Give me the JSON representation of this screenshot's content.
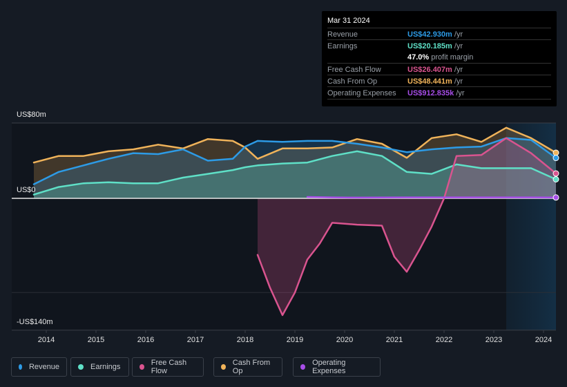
{
  "tooltip": {
    "date": "Mar 31 2024",
    "rows": [
      {
        "label": "Revenue",
        "value": "US$42.930m",
        "unit": "/yr",
        "color": "#2d9be6"
      },
      {
        "label": "Earnings",
        "value": "US$20.185m",
        "unit": "/yr",
        "color": "#5fe0c7"
      },
      {
        "label": "",
        "value": "47.0%",
        "unit": "profit margin",
        "color": "#ffffff"
      },
      {
        "label": "Free Cash Flow",
        "value": "US$26.407m",
        "unit": "/yr",
        "color": "#d9548f"
      },
      {
        "label": "Cash From Op",
        "value": "US$48.441m",
        "unit": "/yr",
        "color": "#f0b35a"
      },
      {
        "label": "Operating Expenses",
        "value": "US$912.835k",
        "unit": "/yr",
        "color": "#a74ee8"
      }
    ]
  },
  "legend": [
    {
      "label": "Revenue",
      "color": "#2d9be6"
    },
    {
      "label": "Earnings",
      "color": "#5fe0c7"
    },
    {
      "label": "Free Cash Flow",
      "color": "#d9548f"
    },
    {
      "label": "Cash From Op",
      "color": "#f0b35a"
    },
    {
      "label": "Operating Expenses",
      "color": "#a74ee8"
    }
  ],
  "chart_data": {
    "type": "area",
    "title": "",
    "xlabel": "",
    "ylabel": "",
    "y_tick_labels": [
      "US$80m",
      "US$0",
      "-US$140m"
    ],
    "ylim": [
      -140,
      80
    ],
    "xlim": [
      2013.75,
      2024.25
    ],
    "x_tick_labels": [
      "2014",
      "2015",
      "2016",
      "2017",
      "2018",
      "2019",
      "2020",
      "2021",
      "2022",
      "2023",
      "2024"
    ],
    "x_ticks": [
      2014,
      2015,
      2016,
      2017,
      2018,
      2019,
      2020,
      2021,
      2022,
      2023,
      2024
    ],
    "forecast_region_start": 2023.25,
    "series": [
      {
        "name": "Cash From Op",
        "color": "#f0b35a",
        "x": [
          2013.75,
          2014.25,
          2014.75,
          2015.25,
          2015.75,
          2016.25,
          2016.75,
          2017.25,
          2017.75,
          2018.0,
          2018.25,
          2018.75,
          2019.25,
          2019.75,
          2020.25,
          2020.75,
          2021.25,
          2021.75,
          2022.25,
          2022.75,
          2023.25,
          2023.75,
          2024.25
        ],
        "values": [
          38,
          45,
          45,
          50,
          52,
          57,
          53,
          63,
          61,
          54,
          42,
          53,
          53,
          54,
          63,
          58,
          43,
          64,
          68,
          60,
          75,
          64,
          48.441
        ]
      },
      {
        "name": "Revenue",
        "color": "#2d9be6",
        "x": [
          2013.75,
          2014.25,
          2014.75,
          2015.25,
          2015.75,
          2016.25,
          2016.75,
          2017.25,
          2017.75,
          2018.0,
          2018.25,
          2018.75,
          2019.25,
          2019.75,
          2020.25,
          2020.75,
          2021.25,
          2021.75,
          2022.25,
          2022.75,
          2023.25,
          2023.75,
          2024.25
        ],
        "values": [
          15,
          28,
          35,
          42,
          48,
          47,
          52,
          40,
          42,
          55,
          61,
          60,
          61,
          61,
          58,
          54,
          49,
          52,
          54,
          55,
          64,
          62,
          42.93
        ]
      },
      {
        "name": "Earnings",
        "color": "#5fe0c7",
        "x": [
          2013.75,
          2014.25,
          2014.75,
          2015.25,
          2015.75,
          2016.25,
          2016.75,
          2017.25,
          2017.75,
          2018.0,
          2018.25,
          2018.75,
          2019.25,
          2019.75,
          2020.25,
          2020.75,
          2021.25,
          2021.75,
          2022.25,
          2022.75,
          2023.25,
          2023.75,
          2024.25
        ],
        "values": [
          4,
          12,
          16,
          17,
          16,
          16,
          22,
          26,
          30,
          33,
          35,
          37,
          38,
          45,
          50,
          45,
          28,
          26,
          36,
          32,
          32,
          32,
          20.185
        ]
      },
      {
        "name": "Free Cash Flow",
        "color": "#d9548f",
        "x": [
          2018.25,
          2018.5,
          2018.75,
          2019.0,
          2019.25,
          2019.5,
          2019.75,
          2020.25,
          2020.75,
          2021.0,
          2021.25,
          2021.5,
          2021.75,
          2022.0,
          2022.25,
          2022.75,
          2023.25,
          2023.75,
          2024.25
        ],
        "values": [
          -60,
          -95,
          -124,
          -100,
          -65,
          -48,
          -26,
          -28,
          -29,
          -62,
          -78,
          -55,
          -30,
          0,
          45,
          46,
          64,
          48,
          26.407
        ]
      },
      {
        "name": "Operating Expenses",
        "color": "#a74ee8",
        "x": [
          2019.25,
          2019.75,
          2020.25,
          2020.75,
          2021.25,
          2021.75,
          2022.25,
          2022.75,
          2023.25,
          2023.75,
          2024.25
        ],
        "values": [
          1.5,
          1,
          0.8,
          0.9,
          1,
          1,
          1,
          1,
          1,
          1,
          0.912835
        ]
      }
    ]
  }
}
